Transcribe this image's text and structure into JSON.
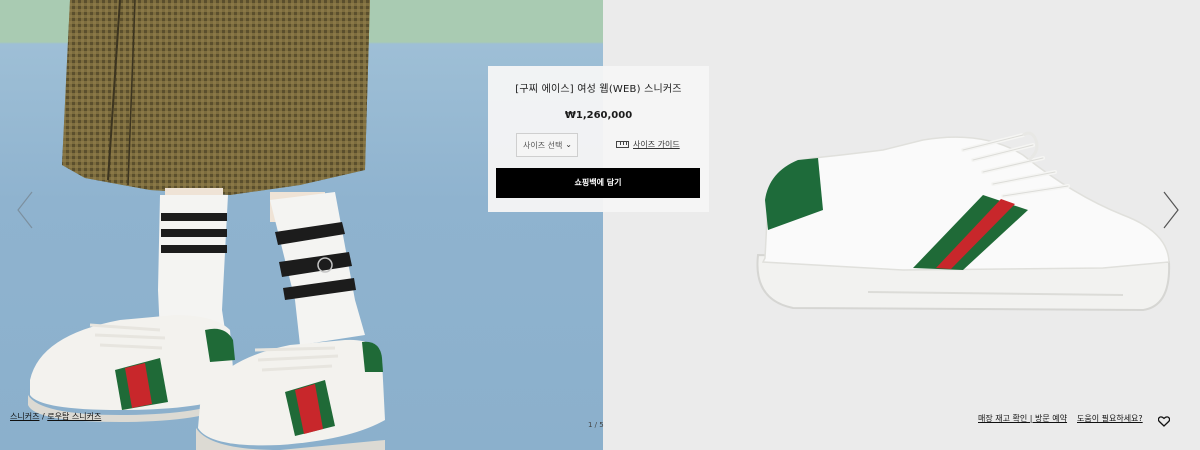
{
  "product": {
    "title": "[구찌 에이스] 여성 웹(WEB) 스니커즈",
    "price": "₩1,260,000",
    "size_select_label": "사이즈 선택",
    "size_guide_label": "사이즈 가이드",
    "add_to_bag_label": "쇼핑백에 담기"
  },
  "breadcrumb": {
    "parent": "스니커즈",
    "separator": "/",
    "current": "로우탑 스니커즈"
  },
  "gallery": {
    "pager": "1 / 5"
  },
  "footer_links": {
    "store_check": "매장 재고 확인 | 방문 예약",
    "help": "도움이 필요하세요?"
  },
  "colors": {
    "stripe_green": "#1f6a37",
    "stripe_red": "#c8272b",
    "button_black": "#000000"
  },
  "icons": [
    "chevron-down-icon",
    "ruler-icon",
    "chevron-right-icon",
    "chevron-left-icon",
    "heart-icon"
  ]
}
